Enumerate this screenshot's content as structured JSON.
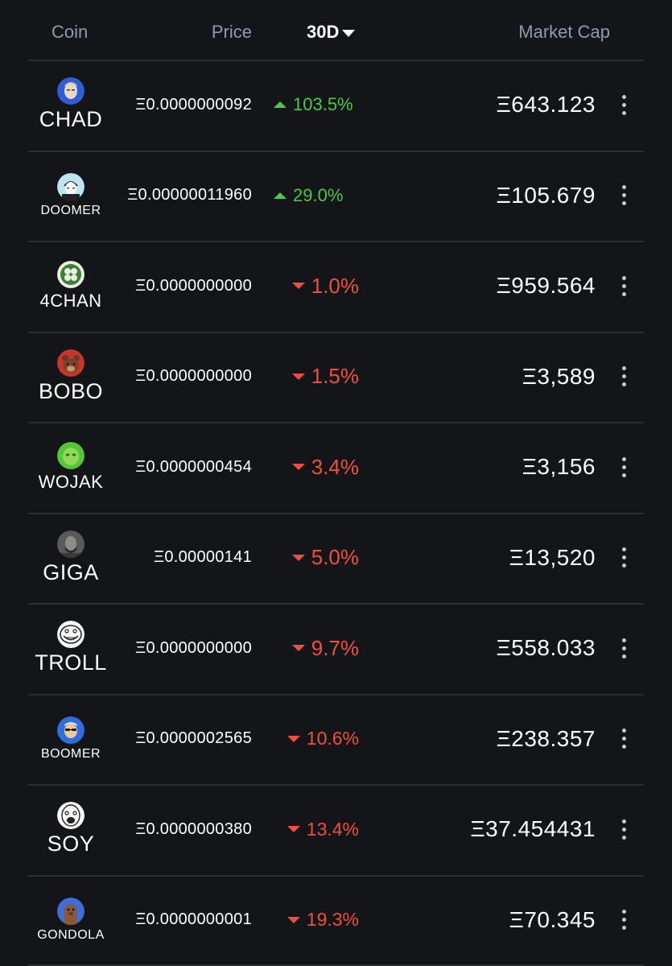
{
  "header": {
    "coin": "Coin",
    "price": "Price",
    "period": "30D",
    "market_cap": "Market Cap"
  },
  "colors": {
    "background": "#141519",
    "up": "#4ec74a",
    "down": "#f24e3e",
    "header_text": "#8e9aae"
  },
  "rows": [
    {
      "symbol": "CHAD",
      "price": "Ξ0.0000000092",
      "change": "103.5%",
      "direction": "up",
      "market_cap": "Ξ643.123",
      "icon": "chad-avatar-icon"
    },
    {
      "symbol": "DOOMER",
      "price": "Ξ0.00000011960",
      "change": "29.0%",
      "direction": "up",
      "market_cap": "Ξ105.679",
      "icon": "doomer-avatar-icon"
    },
    {
      "symbol": "4CHAN",
      "price": "Ξ0.0000000000",
      "change": "1.0%",
      "direction": "down",
      "market_cap": "Ξ959.564",
      "icon": "clover-icon"
    },
    {
      "symbol": "BOBO",
      "price": "Ξ0.0000000000",
      "change": "1.5%",
      "direction": "down",
      "market_cap": "Ξ3,589",
      "icon": "bear-icon"
    },
    {
      "symbol": "WOJAK",
      "price": "Ξ0.0000000454",
      "change": "3.4%",
      "direction": "down",
      "market_cap": "Ξ3,156",
      "icon": "wojak-avatar-icon"
    },
    {
      "symbol": "GIGA",
      "price": "Ξ0.00000141",
      "change": "5.0%",
      "direction": "down",
      "market_cap": "Ξ13,520",
      "icon": "giga-avatar-icon"
    },
    {
      "symbol": "TROLL",
      "price": "Ξ0.0000000000",
      "change": "9.7%",
      "direction": "down",
      "market_cap": "Ξ558.033",
      "icon": "trollface-icon"
    },
    {
      "symbol": "BOOMER",
      "price": "Ξ0.0000002565",
      "change": "10.6%",
      "direction": "down",
      "market_cap": "Ξ238.357",
      "icon": "boomer-avatar-icon"
    },
    {
      "symbol": "SOY",
      "price": "Ξ0.0000000380",
      "change": "13.4%",
      "direction": "down",
      "market_cap": "Ξ37.454431",
      "icon": "soy-avatar-icon"
    },
    {
      "symbol": "GONDOLA",
      "price": "Ξ0.0000000001",
      "change": "19.3%",
      "direction": "down",
      "market_cap": "Ξ70.345",
      "icon": "gondola-avatar-icon"
    }
  ]
}
